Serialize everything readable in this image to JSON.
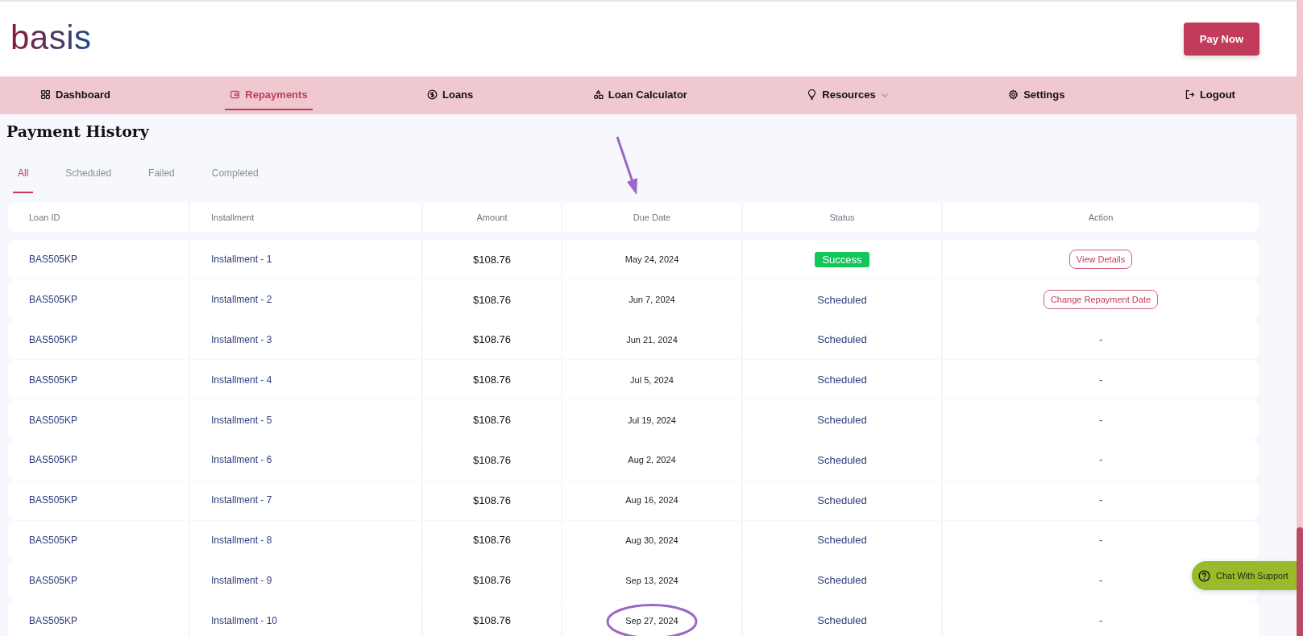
{
  "header": {
    "logo": "basis",
    "pay_button": "Pay Now"
  },
  "nav": [
    {
      "label": "Dashboard",
      "selected": false,
      "dropdown": false
    },
    {
      "label": "Repayments",
      "selected": true,
      "dropdown": false
    },
    {
      "label": "Loans",
      "selected": false,
      "dropdown": false
    },
    {
      "label": "Loan Calculator",
      "selected": false,
      "dropdown": false
    },
    {
      "label": "Resources",
      "selected": false,
      "dropdown": true
    },
    {
      "label": "Settings",
      "selected": false,
      "dropdown": false
    },
    {
      "label": "Logout",
      "selected": false,
      "dropdown": false
    }
  ],
  "page_title": "Payment History",
  "tabs": [
    {
      "label": "All",
      "selected": true
    },
    {
      "label": "Scheduled",
      "selected": false
    },
    {
      "label": "Failed",
      "selected": false
    },
    {
      "label": "Completed",
      "selected": false
    }
  ],
  "table": {
    "columns": [
      "Loan ID",
      "Installment",
      "Amount",
      "Due Date",
      "Status",
      "Action"
    ],
    "rows": [
      {
        "loan_id": "BAS505KP",
        "installment": "Installment - 1",
        "amount": "$108.76",
        "due_date": "May 24, 2024",
        "status": {
          "kind": "badge",
          "text": "Success"
        },
        "action": {
          "kind": "button",
          "text": "View Details"
        }
      },
      {
        "loan_id": "BAS505KP",
        "installment": "Installment - 2",
        "amount": "$108.76",
        "due_date": "Jun 7, 2024",
        "status": {
          "kind": "text",
          "text": "Scheduled"
        },
        "action": {
          "kind": "button",
          "text": "Change Repayment Date"
        }
      },
      {
        "loan_id": "BAS505KP",
        "installment": "Installment - 3",
        "amount": "$108.76",
        "due_date": "Jun 21, 2024",
        "status": {
          "kind": "text",
          "text": "Scheduled"
        },
        "action": {
          "kind": "text",
          "text": "-"
        }
      },
      {
        "loan_id": "BAS505KP",
        "installment": "Installment - 4",
        "amount": "$108.76",
        "due_date": "Jul 5, 2024",
        "status": {
          "kind": "text",
          "text": "Scheduled"
        },
        "action": {
          "kind": "text",
          "text": "-"
        }
      },
      {
        "loan_id": "BAS505KP",
        "installment": "Installment - 5",
        "amount": "$108.76",
        "due_date": "Jul 19, 2024",
        "status": {
          "kind": "text",
          "text": "Scheduled"
        },
        "action": {
          "kind": "text",
          "text": "-"
        }
      },
      {
        "loan_id": "BAS505KP",
        "installment": "Installment - 6",
        "amount": "$108.76",
        "due_date": "Aug 2, 2024",
        "status": {
          "kind": "text",
          "text": "Scheduled"
        },
        "action": {
          "kind": "text",
          "text": "-"
        }
      },
      {
        "loan_id": "BAS505KP",
        "installment": "Installment - 7",
        "amount": "$108.76",
        "due_date": "Aug 16, 2024",
        "status": {
          "kind": "text",
          "text": "Scheduled"
        },
        "action": {
          "kind": "text",
          "text": "-"
        }
      },
      {
        "loan_id": "BAS505KP",
        "installment": "Installment - 8",
        "amount": "$108.76",
        "due_date": "Aug 30, 2024",
        "status": {
          "kind": "text",
          "text": "Scheduled"
        },
        "action": {
          "kind": "text",
          "text": "-"
        }
      },
      {
        "loan_id": "BAS505KP",
        "installment": "Installment - 9",
        "amount": "$108.76",
        "due_date": "Sep 13, 2024",
        "status": {
          "kind": "text",
          "text": "Scheduled"
        },
        "action": {
          "kind": "text",
          "text": "-"
        }
      },
      {
        "loan_id": "BAS505KP",
        "installment": "Installment - 10",
        "amount": "$108.76",
        "due_date": "Sep 27, 2024",
        "status": {
          "kind": "text",
          "text": "Scheduled"
        },
        "action": {
          "kind": "text",
          "text": "-"
        }
      }
    ]
  },
  "chat_button": "Chat With Support"
}
